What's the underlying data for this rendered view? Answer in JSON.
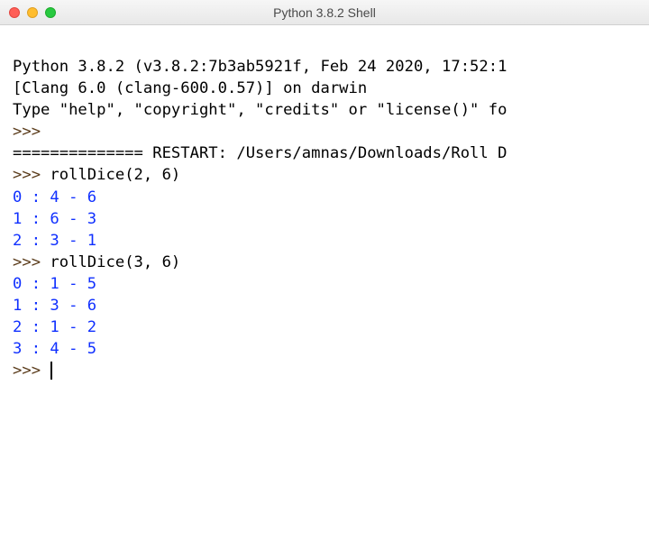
{
  "window": {
    "title": "Python 3.8.2 Shell"
  },
  "banner": {
    "line1": "Python 3.8.2 (v3.8.2:7b3ab5921f, Feb 24 2020, 17:52:1",
    "line2": "[Clang 6.0 (clang-600.0.57)] on darwin",
    "line3": "Type \"help\", \"copyright\", \"credits\" or \"license()\" fo"
  },
  "prompt": ">>> ",
  "restart_line": "============== RESTART: /Users/amnas/Downloads/Roll D",
  "calls": [
    {
      "cmd": "rollDice(2, 6)",
      "output": [
        "0 : 4 - 6",
        "1 : 6 - 3",
        "2 : 3 - 1"
      ]
    },
    {
      "cmd": "rollDice(3, 6)",
      "output": [
        "0 : 1 - 5",
        "1 : 3 - 6",
        "2 : 1 - 2",
        "3 : 4 - 5"
      ]
    }
  ]
}
